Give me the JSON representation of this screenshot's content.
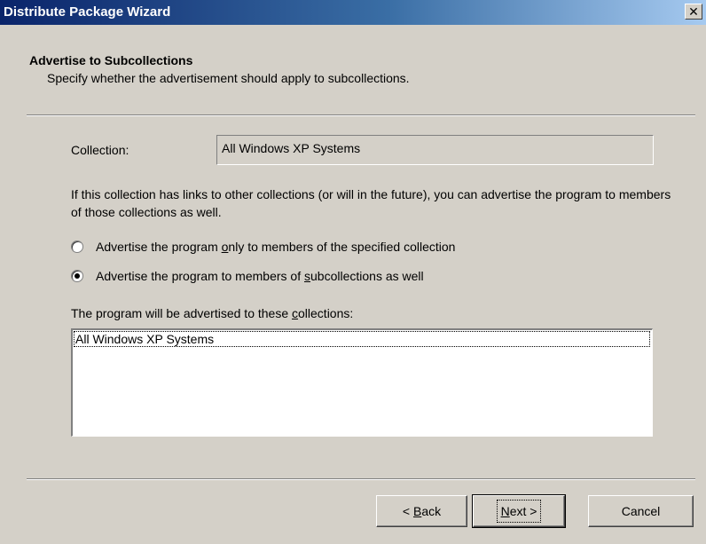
{
  "window": {
    "title": "Distribute Package Wizard",
    "close_glyph": "✕"
  },
  "header": {
    "title": "Advertise to Subcollections",
    "subtitle": "Specify whether the advertisement should apply to subcollections."
  },
  "collection": {
    "label": "Collection:",
    "value": "All Windows XP Systems"
  },
  "description": "If this collection has links to other collections (or will in the future), you can advertise the program to members of those collections as well.",
  "options": [
    {
      "label": "Advertise the program only to members of the specified collection",
      "checked": false
    },
    {
      "label": "Advertise the program to members of subcollections as well",
      "checked": true
    }
  ],
  "list": {
    "label": "The program will be advertised to these collections:",
    "items": [
      "All Windows XP Systems"
    ]
  },
  "buttons": {
    "back": "< Back",
    "next": "Next >",
    "cancel": "Cancel"
  }
}
